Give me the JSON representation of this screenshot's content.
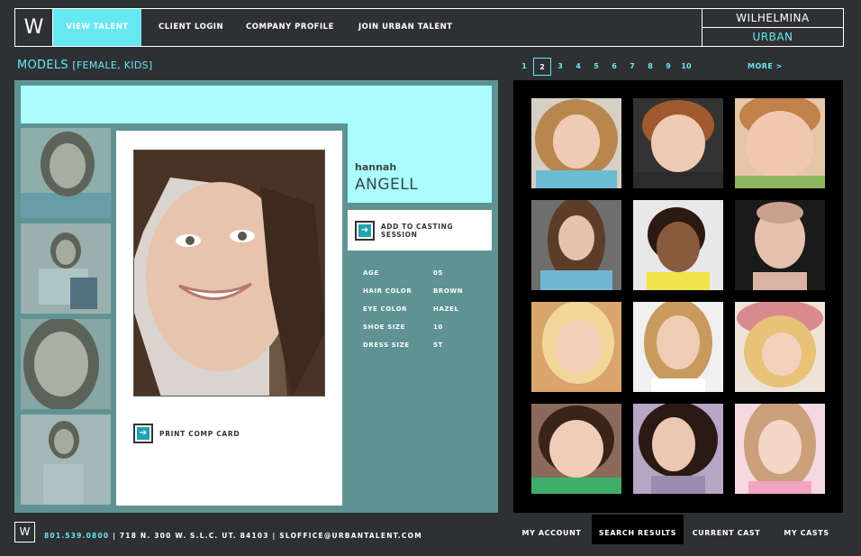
{
  "header": {
    "logo": "W",
    "nav": [
      {
        "label": "VIEW TALENT",
        "active": true
      },
      {
        "label": "CLIENT LOGIN",
        "active": false
      },
      {
        "label": "COMPANY PROFILE",
        "active": false
      },
      {
        "label": "JOIN URBAN TALENT",
        "active": false
      }
    ],
    "brand_top": "WILHELMINA",
    "brand_bottom": "URBAN"
  },
  "models": {
    "title": "MODELS",
    "filter": "[FEMALE, KIDS]"
  },
  "pagination": {
    "pages": [
      "1",
      "2",
      "3",
      "4",
      "5",
      "6",
      "7",
      "8",
      "9",
      "10"
    ],
    "current": "2",
    "more_label": "MORE >"
  },
  "profile": {
    "first_name": "hannah",
    "last_name": "ANGELL",
    "add_to_casting_label": "ADD TO CASTING SESSION",
    "print_label": "PRINT COMP CARD",
    "stats": [
      {
        "label": "AGE",
        "value": "05"
      },
      {
        "label": "HAIR COLOR",
        "value": "BROWN"
      },
      {
        "label": "EYE COLOR",
        "value": "HAZEL"
      },
      {
        "label": "SHOE SIZE",
        "value": "10"
      },
      {
        "label": "DRESS SIZE",
        "value": "5T"
      }
    ]
  },
  "footer": {
    "logo": "W",
    "phone": "801.539.0800",
    "address": "| 718 N. 300 W. S.L.C. UT. 84103 | SLOFFICE@URBANTALENT.COM",
    "tabs": [
      {
        "label": "MY ACCOUNT",
        "active": false
      },
      {
        "label": "SEARCH RESULTS",
        "active": true
      },
      {
        "label": "CURRENT CAST",
        "active": false
      },
      {
        "label": "MY CASTS",
        "active": false
      }
    ]
  },
  "colors": {
    "accent": "#66e8f2",
    "panel": "#5f9393",
    "light_cyan": "#aafcfe",
    "background": "#2e3033"
  }
}
